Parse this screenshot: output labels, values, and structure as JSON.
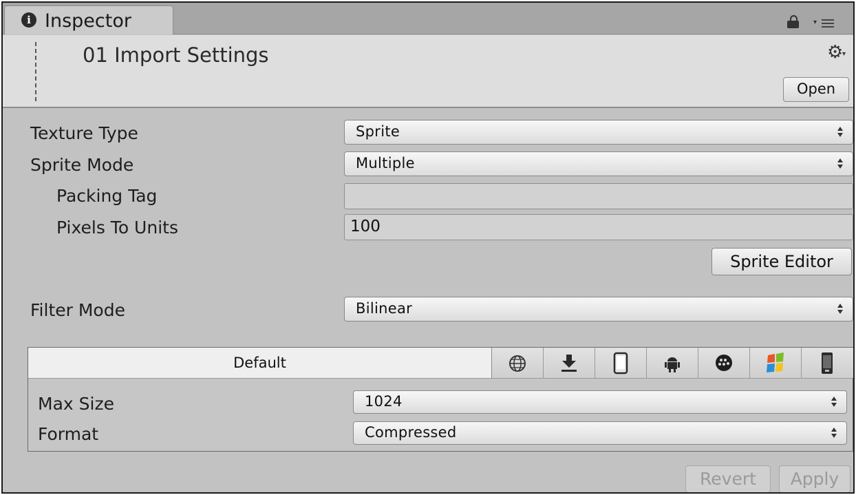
{
  "tab": {
    "title": "Inspector",
    "info_icon": "i"
  },
  "header": {
    "asset_name": "01 Import Settings",
    "open_label": "Open"
  },
  "properties": {
    "texture_type": {
      "label": "Texture Type",
      "value": "Sprite"
    },
    "sprite_mode": {
      "label": "Sprite Mode",
      "value": "Multiple"
    },
    "packing_tag": {
      "label": "Packing Tag",
      "value": ""
    },
    "pixels_to_units": {
      "label": "Pixels To Units",
      "value": "100"
    },
    "sprite_editor_label": "Sprite Editor",
    "filter_mode": {
      "label": "Filter Mode",
      "value": "Bilinear"
    }
  },
  "platforms": {
    "default_label": "Default",
    "icons": [
      "globe-icon",
      "download-icon",
      "phone-icon",
      "android-icon",
      "blackberry-icon",
      "windows-icon",
      "windows-phone-icon"
    ],
    "max_size": {
      "label": "Max Size",
      "value": "1024"
    },
    "format": {
      "label": "Format",
      "value": "Compressed"
    }
  },
  "footer": {
    "revert_label": "Revert",
    "apply_label": "Apply"
  }
}
